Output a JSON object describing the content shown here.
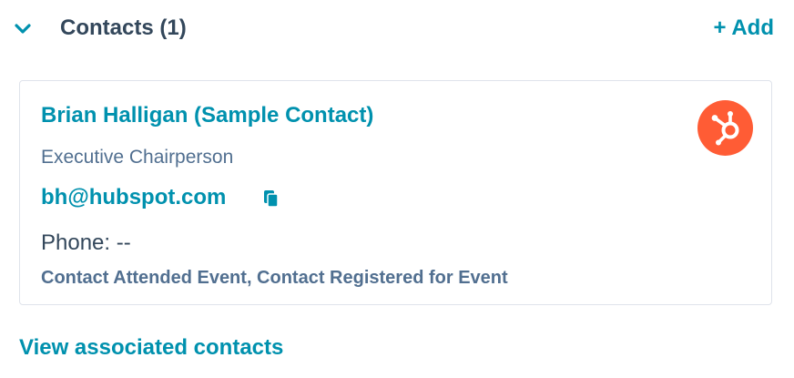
{
  "section": {
    "title": "Contacts (1)",
    "add_label": "+ Add",
    "collapse_icon": "chevron-down-icon"
  },
  "contact": {
    "name": "Brian Halligan (Sample Contact)",
    "job_title": "Executive Chairperson",
    "email": "bh@hubspot.com",
    "copy_icon": "copy-icon",
    "phone": "Phone: --",
    "events": "Contact Attended Event, Contact Registered for Event",
    "logo_icon": "hubspot-sprocket-icon"
  },
  "footer": {
    "view_link": "View associated contacts"
  },
  "colors": {
    "accent": "#0091ae",
    "heading": "#33475b",
    "muted": "#516f90",
    "brand": "#ff5c35",
    "border": "#dfe3eb"
  }
}
